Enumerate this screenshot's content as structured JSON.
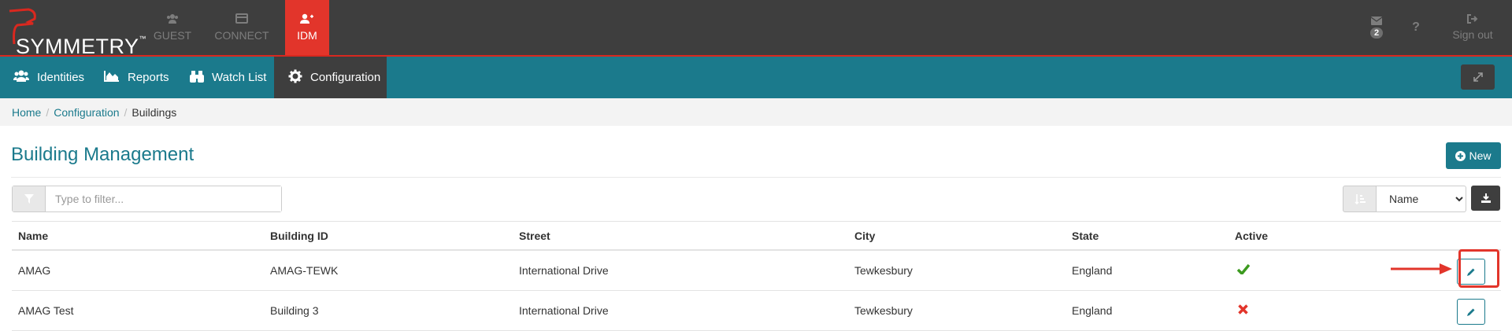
{
  "app": {
    "logo_text": "SYMMETRY",
    "logo_tm": "™",
    "apps": [
      {
        "label": "GUEST",
        "icon": "users-icon"
      },
      {
        "label": "CONNECT",
        "icon": "card-icon"
      },
      {
        "label": "IDM",
        "icon": "add-user-icon"
      }
    ],
    "mail_count": "2",
    "sign_out": "Sign out"
  },
  "nav": {
    "items": [
      {
        "label": "Identities",
        "icon": "users-icon"
      },
      {
        "label": "Reports",
        "icon": "area-chart-icon"
      },
      {
        "label": "Watch List",
        "icon": "binoculars-icon"
      },
      {
        "label": "Configuration",
        "icon": "gear-icon"
      }
    ]
  },
  "breadcrumb": [
    "Home",
    "Configuration",
    "Buildings"
  ],
  "page": {
    "title": "Building Management",
    "new_label": "New"
  },
  "filter": {
    "placeholder": "Type to filter...",
    "sort_options": [
      "Name"
    ],
    "sort_value": "Name"
  },
  "table": {
    "columns": [
      "Name",
      "Building ID",
      "Street",
      "City",
      "State",
      "Active"
    ],
    "rows": [
      {
        "name": "AMAG",
        "building_id": "AMAG-TEWK",
        "street": "International Drive",
        "city": "Tewkesbury",
        "state": "England",
        "active": true
      },
      {
        "name": "AMAG Test",
        "building_id": "Building 3",
        "street": "International Drive",
        "city": "Tewkesbury",
        "state": "England",
        "active": false
      }
    ]
  },
  "colors": {
    "teal": "#1b7a8c",
    "dark": "#3e3e3e",
    "accent_red": "#e2352b",
    "check_green": "#3c9a1f",
    "cross_red": "#e2352b"
  }
}
